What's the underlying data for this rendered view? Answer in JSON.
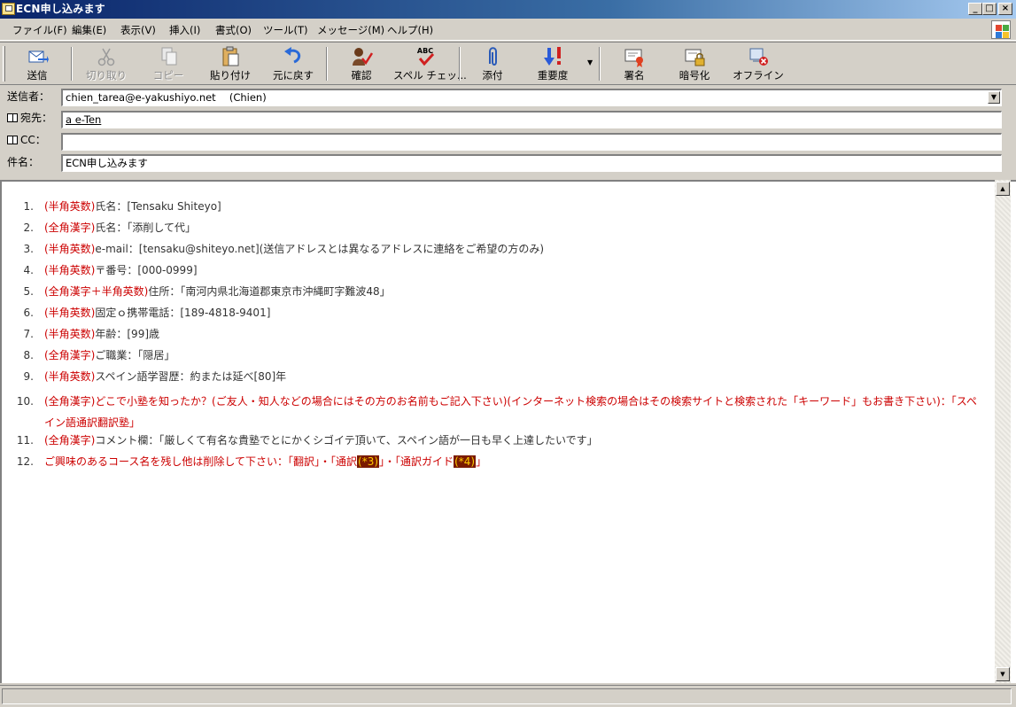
{
  "window": {
    "title": "ECN申し込みます",
    "minimize_glyph": "_",
    "maximize_glyph": "□",
    "close_glyph": "×"
  },
  "menu": [
    {
      "label": "ファイル(F)"
    },
    {
      "label": "編集(E)"
    },
    {
      "label": "表示(V)"
    },
    {
      "label": "挿入(I)"
    },
    {
      "label": "書式(O)"
    },
    {
      "label": "ツール(T)"
    },
    {
      "label": "メッセージ(M)"
    },
    {
      "label": "ヘルプ(H)"
    }
  ],
  "toolbar": {
    "send": "送信",
    "cut": "切り取り",
    "copy": "コピー",
    "paste": "貼り付け",
    "undo": "元に戻す",
    "check": "確認",
    "spell": "スペル チェッ...",
    "spell_icon_text": "ABC",
    "attach": "添付",
    "priority": "重要度",
    "sign": "署名",
    "encrypt": "暗号化",
    "offline": "オフライン"
  },
  "headers": {
    "from_label": "送信者：",
    "from_value": "chien_tarea@e-yakushiyo.net　 (Chien)",
    "to_label": "宛先：",
    "to_value": "a e-Ten",
    "cc_label": "CC：",
    "cc_value": "",
    "subject_label": "件名：",
    "subject_value": "ECN申し込みます"
  },
  "body": {
    "items": [
      {
        "num": "1.",
        "tag": "(半角英数)",
        "text": "氏名：[Tensaku Shiteyo]"
      },
      {
        "num": "2.",
        "tag": "(全角漢字)",
        "text": "氏名：「添削して代」"
      },
      {
        "num": "3.",
        "tag": "(半角英数)",
        "text": "e-mail：[tensaku@shiteyo.net](送信アドレスとは異なるアドレスに連絡をご希望の方のみ)"
      },
      {
        "num": "4.",
        "tag": "(半角英数)",
        "text": "〒番号：[000-0999]"
      },
      {
        "num": "5.",
        "tag": "(全角漢字＋半角英数)",
        "text": "住所：「南河内県北海道郡東京市沖縄町字難波48」"
      },
      {
        "num": "6.",
        "tag": "(半角英数)",
        "text": "固定ｏ携帯電話：[189-4818-9401]"
      },
      {
        "num": "7.",
        "tag": "(半角英数)",
        "text": "年齢：[99]歳"
      },
      {
        "num": "8.",
        "tag": "(全角漢字)",
        "text": "ご職業：「隠居」"
      },
      {
        "num": "9.",
        "tag": "(半角英数)",
        "text": "スペイン語学習歴：約または延べ[80]年"
      },
      {
        "num": "10.",
        "tag": "(全角漢字)",
        "text": "どこで小塾を知ったか？(ご友人・知人などの場合にはその方のお名前もご記入下さい)(インターネット検索の場合はその検索サイトと検索された「キーワード」もお書き下さい)：「スペイン語通訳翻訳塾」"
      },
      {
        "num": "11.",
        "tag": "(全角漢字)",
        "text": "コメント欄：「厳しくて有名な貴塾でとにかくシゴイテ頂いて、スペイン語が一日も早く上達したいです」"
      }
    ],
    "item12": {
      "num": "12.",
      "text_a": "ご興味のあるコース名を残し他は削除して下さい：「翻訳」・「通訳",
      "mark_a": "(*3)",
      "text_b": "」・「通訳ガイド",
      "mark_b": "(*4)",
      "text_c": "」"
    }
  }
}
